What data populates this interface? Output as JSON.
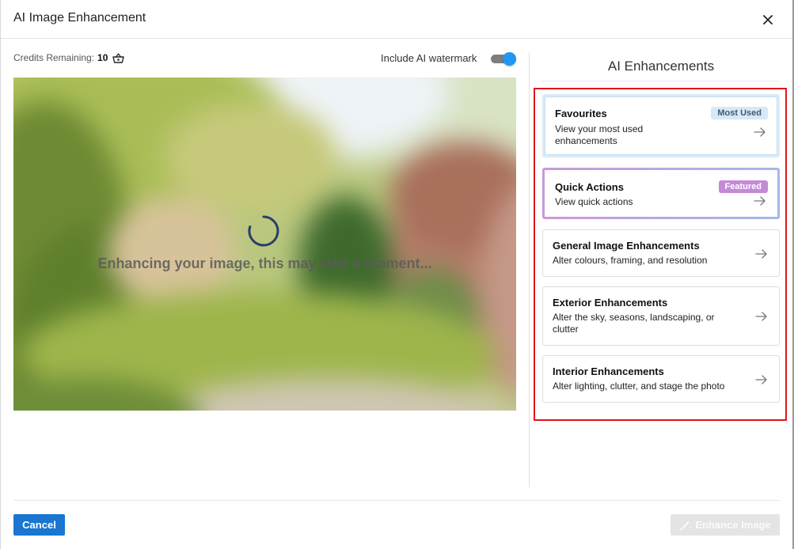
{
  "dialog": {
    "title": "AI Image Enhancement",
    "close_icon": "close-icon"
  },
  "toolbar": {
    "credits_label": "Credits Remaining:",
    "credits_value": "10",
    "credits_icon": "basket-icon",
    "watermark_label": "Include AI watermark",
    "watermark_enabled": true
  },
  "preview": {
    "status_text": "Enhancing your image, this may take a moment...",
    "spinner_icon": "loading-spinner-icon"
  },
  "panel": {
    "title": "AI Enhancements",
    "cards": [
      {
        "title": "Favourites",
        "description": "View your most used enhancements",
        "badge": "Most Used"
      },
      {
        "title": "Quick Actions",
        "description": "View quick actions",
        "badge": "Featured"
      },
      {
        "title": "General Image Enhancements",
        "description": "Alter colours, framing, and resolution"
      },
      {
        "title": "Exterior Enhancements",
        "description": "Alter the sky, seasons, landscaping, or clutter"
      },
      {
        "title": "Interior Enhancements",
        "description": "Alter lighting, clutter, and stage the photo"
      }
    ]
  },
  "footer": {
    "cancel_label": "Cancel",
    "enhance_label": "Enhance Image",
    "enhance_icon": "magic-wand-icon"
  },
  "colors": {
    "primary": "#1976d2",
    "toggle_on": "#2196f3",
    "highlight": "#e0161a",
    "badge_most_used": "#d7e8f6",
    "badge_featured": "#c48ad8"
  }
}
